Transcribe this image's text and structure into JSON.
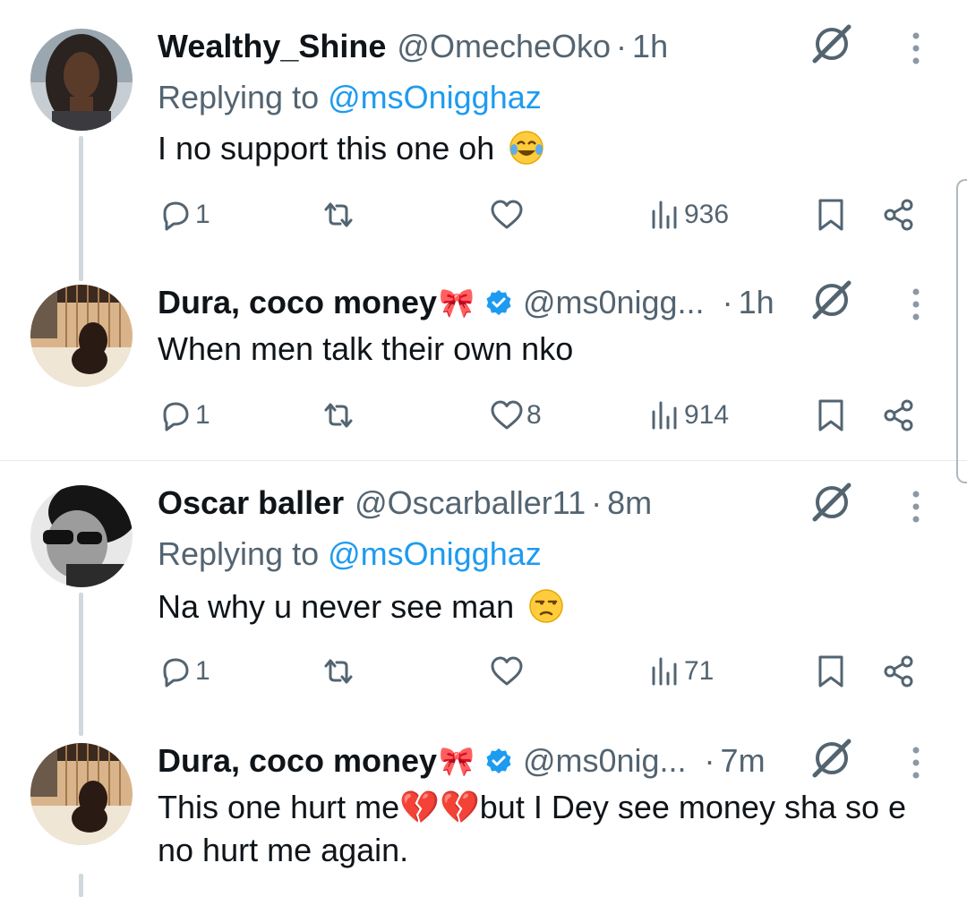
{
  "tweets": [
    {
      "name": "Wealthy_Shine",
      "handle": "@OmecheOko",
      "time": "1h",
      "replying_label": "Replying to ",
      "replying_to": "@msOnigghaz",
      "text": "I no support this one oh",
      "emoji": "face-with-tears-of-joy",
      "replies": "1",
      "reposts": "",
      "likes": "",
      "views": "936"
    },
    {
      "name": "Dura, coco money",
      "ribbon": "🎀",
      "verified": true,
      "handle": "@ms0nigg...",
      "time": "1h",
      "text": "When men talk their own nko",
      "replies": "1",
      "reposts": "",
      "likes": "8",
      "views": "914"
    },
    {
      "name": "Oscar baller",
      "handle": "@Oscarballer11",
      "time": "8m",
      "replying_label": "Replying to ",
      "replying_to": "@msOnigghaz",
      "text": "Na why u never see man",
      "emoji": "unamused-face",
      "replies": "1",
      "reposts": "",
      "likes": "",
      "views": "71"
    },
    {
      "name": "Dura, coco money",
      "ribbon": "🎀",
      "verified": true,
      "handle": "@ms0nig...",
      "time": "7m",
      "text_before": "This one hurt me",
      "broken_hearts": "💔💔",
      "text_after": "but I Dey see money sha so e no hurt me again."
    }
  ],
  "separator": "·",
  "colors": {
    "text": "#0f1419",
    "secondary": "#536471",
    "link": "#1d9bf0",
    "verified": "#1d9bf0",
    "thread_line": "#cfd9de"
  },
  "icons": [
    "reply-icon",
    "repost-icon",
    "like-icon",
    "views-icon",
    "bookmark-icon",
    "share-icon",
    "grok-icon",
    "more-icon",
    "verified-badge-icon"
  ]
}
